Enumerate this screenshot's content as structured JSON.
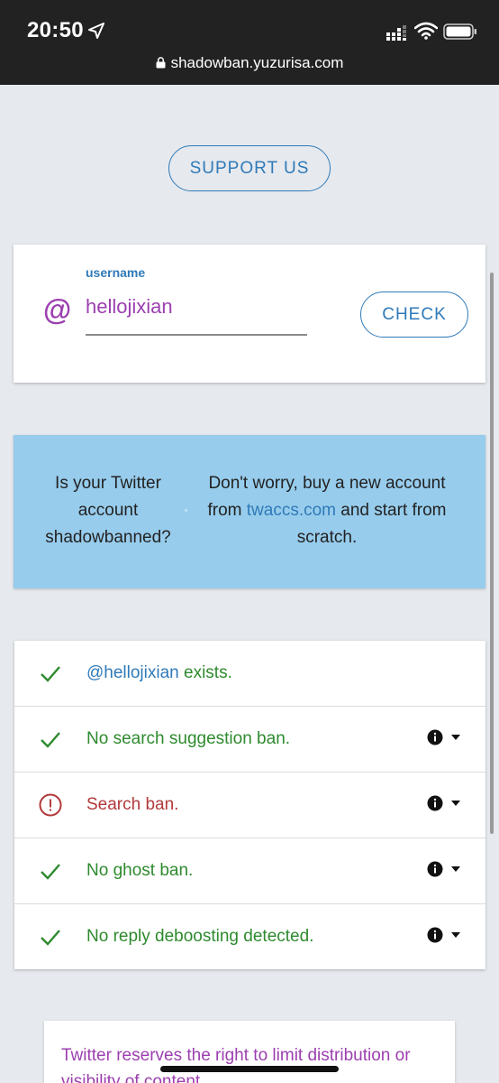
{
  "status_bar": {
    "time": "20:50",
    "url": "shadowban.yuzurisa.com",
    "icons": [
      "location-arrow-icon",
      "cellular-signal-icon",
      "wifi-icon",
      "battery-icon",
      "lock-icon"
    ]
  },
  "support": {
    "label": "SUPPORT US"
  },
  "search": {
    "at_symbol": "@",
    "label": "username",
    "value": "hellojixian",
    "check_label": "CHECK"
  },
  "ad": {
    "left_text": "Is your Twitter account shadowbanned?",
    "right_before": "Don't worry, buy a new account from",
    "right_link": "twaccs.com",
    "right_after": "and start from scratch."
  },
  "results": {
    "exists_handle": "@hellojixian",
    "exists_text": "exists.",
    "rows": [
      {
        "text": "No search suggestion ban.",
        "status": "ok"
      },
      {
        "text": "Search ban.",
        "status": "bad"
      },
      {
        "text": "No ghost ban.",
        "status": "ok"
      },
      {
        "text": "No reply deboosting detected.",
        "status": "ok"
      }
    ]
  },
  "notice": {
    "text": "Twitter reserves the right to limit distribution or visibility of content."
  },
  "colors": {
    "accent": "#2f7ab8",
    "purple": "#9c3fb0",
    "ok": "#2e8a2e",
    "bad": "#b23a3a",
    "banner": "#97ccec"
  }
}
